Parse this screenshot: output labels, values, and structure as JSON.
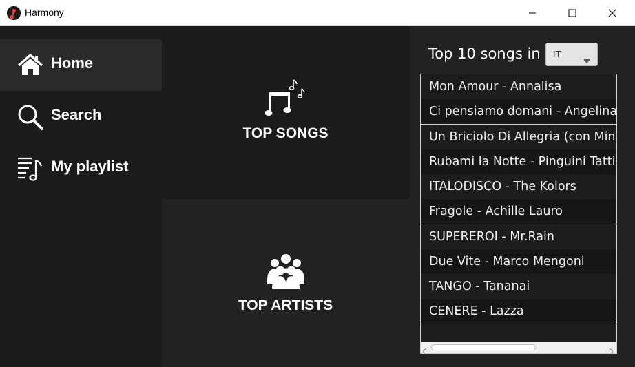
{
  "window": {
    "title": "Harmony",
    "controls": [
      "minimize-icon",
      "maximize-icon",
      "close-icon"
    ]
  },
  "sidebar": {
    "items": [
      {
        "label": "Home",
        "icon": "home-icon",
        "active": true
      },
      {
        "label": "Search",
        "icon": "search-icon",
        "active": false
      },
      {
        "label": "My playlist",
        "icon": "playlist-icon",
        "active": false
      }
    ]
  },
  "tiles": {
    "top_songs": {
      "label": "TOP SONGS",
      "icon": "music-notes-icon"
    },
    "top_artists": {
      "label": "TOP ARTISTS",
      "icon": "people-group-icon"
    }
  },
  "top10": {
    "label": "Top 10 songs in",
    "country": "IT",
    "songs": [
      "Mon Amour - Annalisa",
      "Ci pensiamo domani - Angelina Mango",
      "Un Briciolo Di Allegria (con Mina) - Blanco",
      "Rubami la Notte - Pinguini Tattici Nucleari",
      "ITALODISCO - The Kolors",
      "Fragole - Achille Lauro",
      "SUPEREROI - Mr.Rain",
      "Due Vite - Marco Mengoni",
      "TANGO - Tananai",
      "CENERE - Lazza"
    ]
  },
  "colors": {
    "background": "#1b1b1d",
    "panel": "#222224",
    "active_nav": "#2a2a2c",
    "text": "#ffffff"
  }
}
